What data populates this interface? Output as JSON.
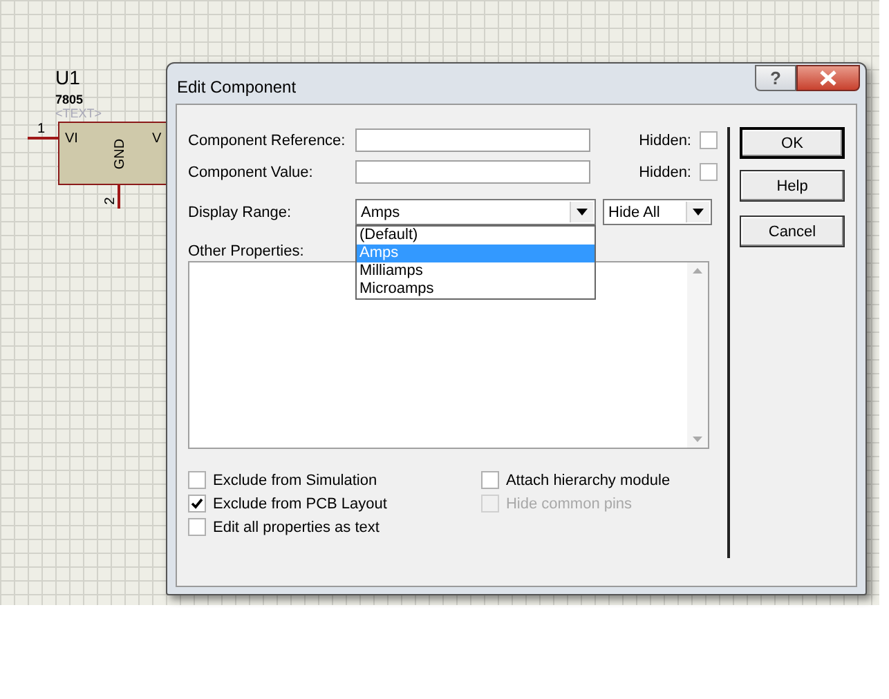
{
  "canvas": {
    "component": {
      "reference": "U1",
      "value": "7805",
      "text": "<TEXT>",
      "pin_left": {
        "number": "1",
        "name": "VI"
      },
      "pin_bottom": {
        "number": "2",
        "name": "GND"
      },
      "pin_right": {
        "name": "V"
      }
    }
  },
  "dialog": {
    "title": "Edit Component",
    "help_glyph": "?",
    "fields": [
      {
        "label": "Component Reference:",
        "hidden_label": "Hidden:",
        "hidden": false
      },
      {
        "label": "Component Value:",
        "hidden_label": "Hidden:",
        "hidden": false
      }
    ],
    "display_range": {
      "label": "Display Range:",
      "value": "Amps",
      "visibility": "Hide All",
      "options": [
        {
          "label": "(Default)",
          "selected": false
        },
        {
          "label": "Amps",
          "selected": true
        },
        {
          "label": "Milliamps",
          "selected": false
        },
        {
          "label": "Microamps",
          "selected": false
        }
      ]
    },
    "other_properties": {
      "label": "Other Properties:"
    },
    "left_options": [
      {
        "label": "Exclude from Simulation",
        "checked": false,
        "disabled": false
      },
      {
        "label": "Exclude from PCB Layout",
        "checked": true,
        "disabled": false
      },
      {
        "label": "Edit all properties as text",
        "checked": false,
        "disabled": false
      }
    ],
    "right_options": [
      {
        "label": "Attach hierarchy module",
        "checked": false,
        "disabled": false
      },
      {
        "label": "Hide common pins",
        "checked": false,
        "disabled": true
      }
    ],
    "buttons": [
      {
        "label": "OK",
        "default": true
      },
      {
        "label": "Help",
        "default": false
      },
      {
        "label": "Cancel",
        "default": false
      }
    ]
  }
}
